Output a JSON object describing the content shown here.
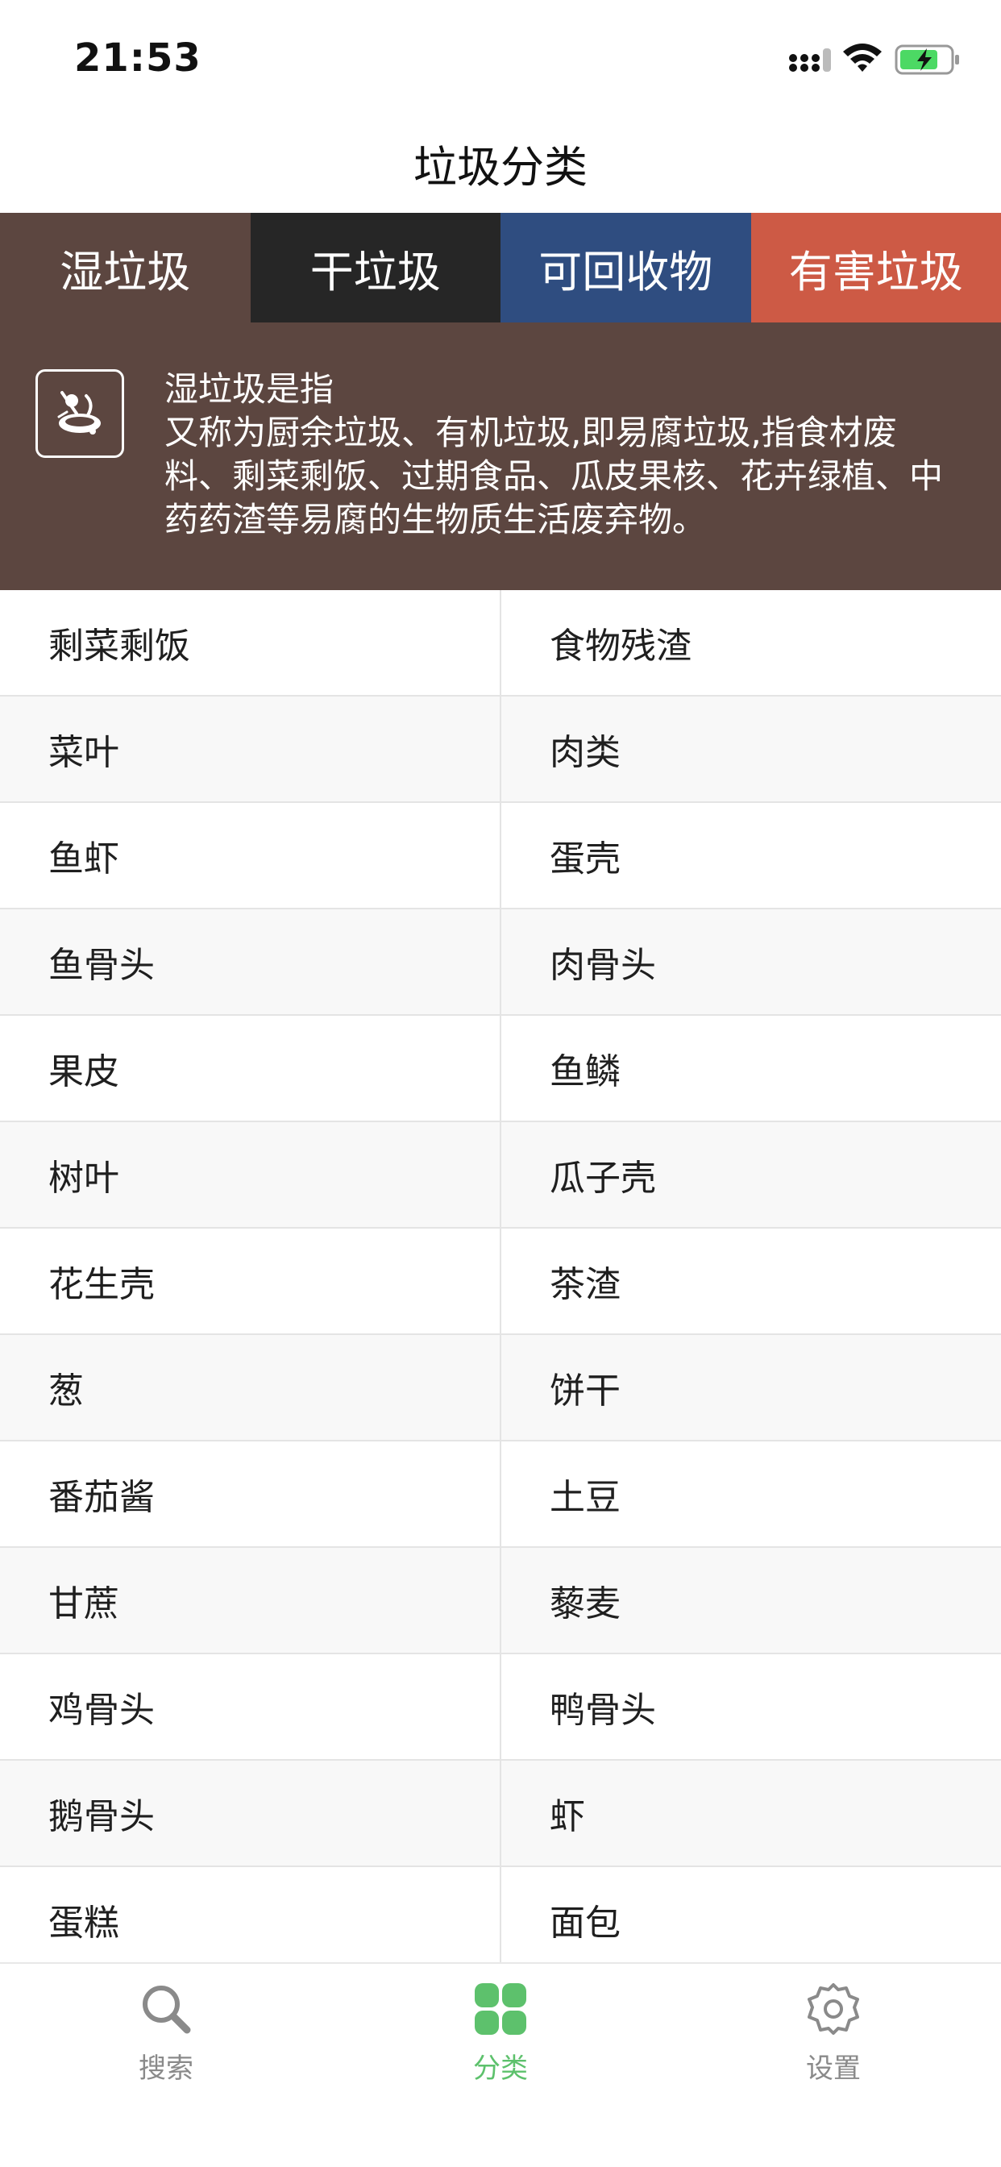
{
  "status_bar": {
    "time": "21:53"
  },
  "nav": {
    "title": "垃圾分类"
  },
  "tabs": [
    {
      "label": "湿垃圾",
      "color": "#5c4640",
      "selected": true
    },
    {
      "label": "干垃圾",
      "color": "#262626",
      "selected": false
    },
    {
      "label": "可回收物",
      "color": "#2f4d80",
      "selected": false
    },
    {
      "label": "有害垃圾",
      "color": "#cd5a45",
      "selected": false
    }
  ],
  "description": {
    "icon": "wet-garbage-icon",
    "title": "湿垃圾是指",
    "body": "又称为厨余垃圾、有机垃圾,即易腐垃圾,指食材废料、剩菜剩饭、过期食品、瓜皮果核、花卉绿植、中药药渣等易腐的生物质生活废弃物。"
  },
  "items": [
    [
      "剩菜剩饭",
      "食物残渣"
    ],
    [
      "菜叶",
      "肉类"
    ],
    [
      "鱼虾",
      "蛋壳"
    ],
    [
      "鱼骨头",
      "肉骨头"
    ],
    [
      "果皮",
      "鱼鳞"
    ],
    [
      "树叶",
      "瓜子壳"
    ],
    [
      "花生壳",
      "茶渣"
    ],
    [
      "葱",
      "饼干"
    ],
    [
      "番茄酱",
      "土豆"
    ],
    [
      "甘蔗",
      "藜麦"
    ],
    [
      "鸡骨头",
      "鸭骨头"
    ],
    [
      "鹅骨头",
      "虾"
    ],
    [
      "蛋糕",
      "面包"
    ]
  ],
  "tab_bar": [
    {
      "label": "搜索",
      "icon": "search-icon",
      "active": false
    },
    {
      "label": "分类",
      "icon": "category-grid-icon",
      "active": true
    },
    {
      "label": "设置",
      "icon": "gear-icon",
      "active": false
    }
  ],
  "colors": {
    "accent_green": "#5dc16c",
    "inactive_gray": "#8a8a8a"
  }
}
